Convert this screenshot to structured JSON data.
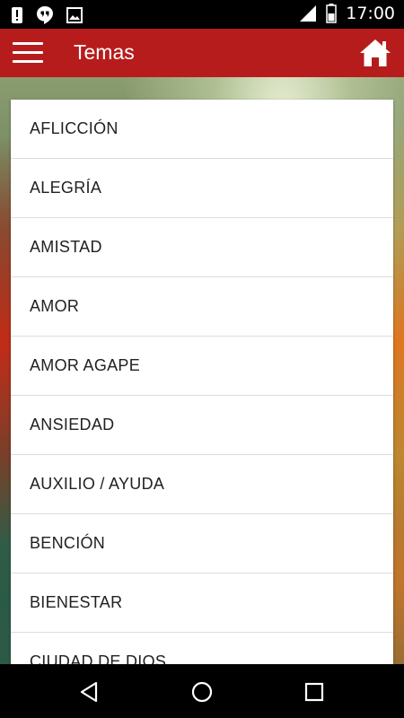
{
  "status_bar": {
    "time": "17:00",
    "left_icons": [
      "alert-icon",
      "hangouts-icon",
      "image-icon"
    ],
    "right_icons": [
      "signal-icon",
      "battery-icon"
    ]
  },
  "app_bar": {
    "title": "Temas",
    "menu_icon": "hamburger-menu-icon",
    "home_icon": "home-icon",
    "color": "#B71C1C"
  },
  "topics": [
    "AFLICCIÓN",
    "ALEGRÍA",
    "AMISTAD",
    "AMOR",
    "AMOR AGAPE",
    "ANSIEDAD",
    "AUXILIO / AYUDA",
    "BENCIÓN",
    "BIENESTAR",
    "CIUDAD DE DIOS"
  ],
  "nav_bar": {
    "icons": [
      "back-icon",
      "home-circle-icon",
      "recents-icon"
    ]
  }
}
